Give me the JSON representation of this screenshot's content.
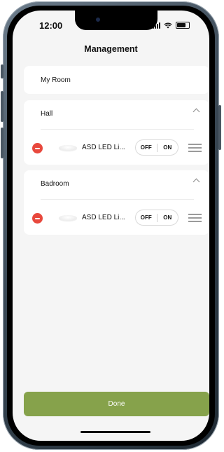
{
  "status_bar": {
    "time": "12:00"
  },
  "header": {
    "title": "Management"
  },
  "rooms": [
    {
      "name": "My Room"
    },
    {
      "name": "Hall",
      "devices": [
        {
          "name": "ASD LED Li...",
          "off_label": "OFF",
          "on_label": "ON"
        }
      ]
    },
    {
      "name": "Badroom",
      "devices": [
        {
          "name": "ASD LED Li...",
          "off_label": "OFF",
          "on_label": "ON"
        }
      ]
    }
  ],
  "footer": {
    "done_label": "Done"
  },
  "colors": {
    "accent": "#86a24b",
    "remove": "#e8483d",
    "background": "#f5f5f5"
  },
  "icons": [
    "remove-icon",
    "lamp-icon",
    "drag-handle-icon",
    "chevron-up-icon",
    "signal-icon",
    "wifi-icon",
    "battery-icon"
  ]
}
